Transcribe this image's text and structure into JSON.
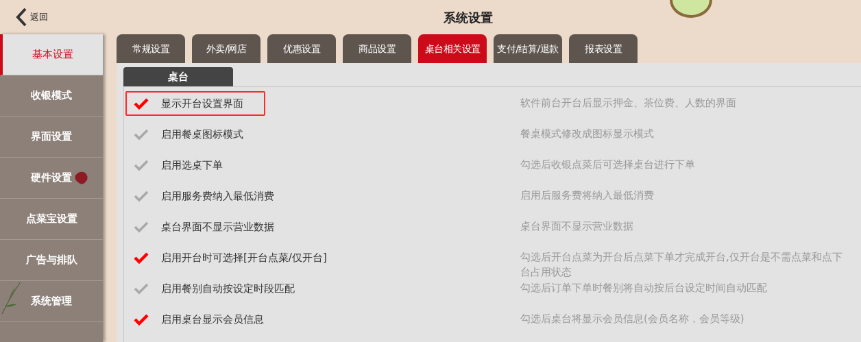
{
  "header": {
    "back_label": "返回",
    "title": "系统设置"
  },
  "sidebar": {
    "items": [
      {
        "label": "基本设置",
        "selected": true
      },
      {
        "label": "收银模式",
        "selected": false
      },
      {
        "label": "界面设置",
        "selected": false
      },
      {
        "label": "硬件设置",
        "selected": false
      },
      {
        "label": "点菜宝设置",
        "selected": false
      },
      {
        "label": "广告与排队",
        "selected": false
      },
      {
        "label": "系统管理",
        "selected": false
      }
    ]
  },
  "tabs": [
    {
      "label": "常规设置",
      "selected": false
    },
    {
      "label": "外卖/网店",
      "selected": false
    },
    {
      "label": "优惠设置",
      "selected": false
    },
    {
      "label": "商品设置",
      "selected": false
    },
    {
      "label": "桌台相关设置",
      "selected": true
    },
    {
      "label": "支付/结算/退款",
      "selected": false
    },
    {
      "label": "报表设置",
      "selected": false
    }
  ],
  "section": {
    "title": "桌台"
  },
  "options": [
    {
      "label": "显示开台设置界面",
      "checked": true,
      "highlighted": true,
      "description": [
        "软件前台开台后显示押金、茶位费、人数的界面"
      ]
    },
    {
      "label": "启用餐桌图标模式",
      "checked": false,
      "highlighted": false,
      "description": [
        "餐桌模式修改成图标显示模式"
      ]
    },
    {
      "label": "启用选桌下单",
      "checked": false,
      "highlighted": false,
      "description": [
        "勾选后收银点菜后可选择桌台进行下单"
      ]
    },
    {
      "label": "启用服务费纳入最低消费",
      "checked": false,
      "highlighted": false,
      "description": [
        "启用后服务费将纳入最低消费"
      ]
    },
    {
      "label": "桌台界面不显示营业数据",
      "checked": false,
      "highlighted": false,
      "description": [
        "桌台界面不显示营业数据"
      ]
    },
    {
      "label": "启用开台时可选择[开台点菜/仅开台]",
      "checked": true,
      "highlighted": false,
      "description": [
        "勾选后开台点菜为开台后点菜下单才完成开台,仅开台是不需点菜和点下",
        "台占用状态"
      ]
    },
    {
      "label": "启用餐别自动按设定时段匹配",
      "checked": false,
      "highlighted": false,
      "description": [
        "勾选后订单下单时餐别将自动按后台设定时间自动匹配"
      ]
    },
    {
      "label": "启用桌台显示会员信息",
      "checked": true,
      "highlighted": false,
      "description": [
        "勾选后桌台将显示会员信息(会员名称，会员等级)"
      ]
    }
  ]
}
